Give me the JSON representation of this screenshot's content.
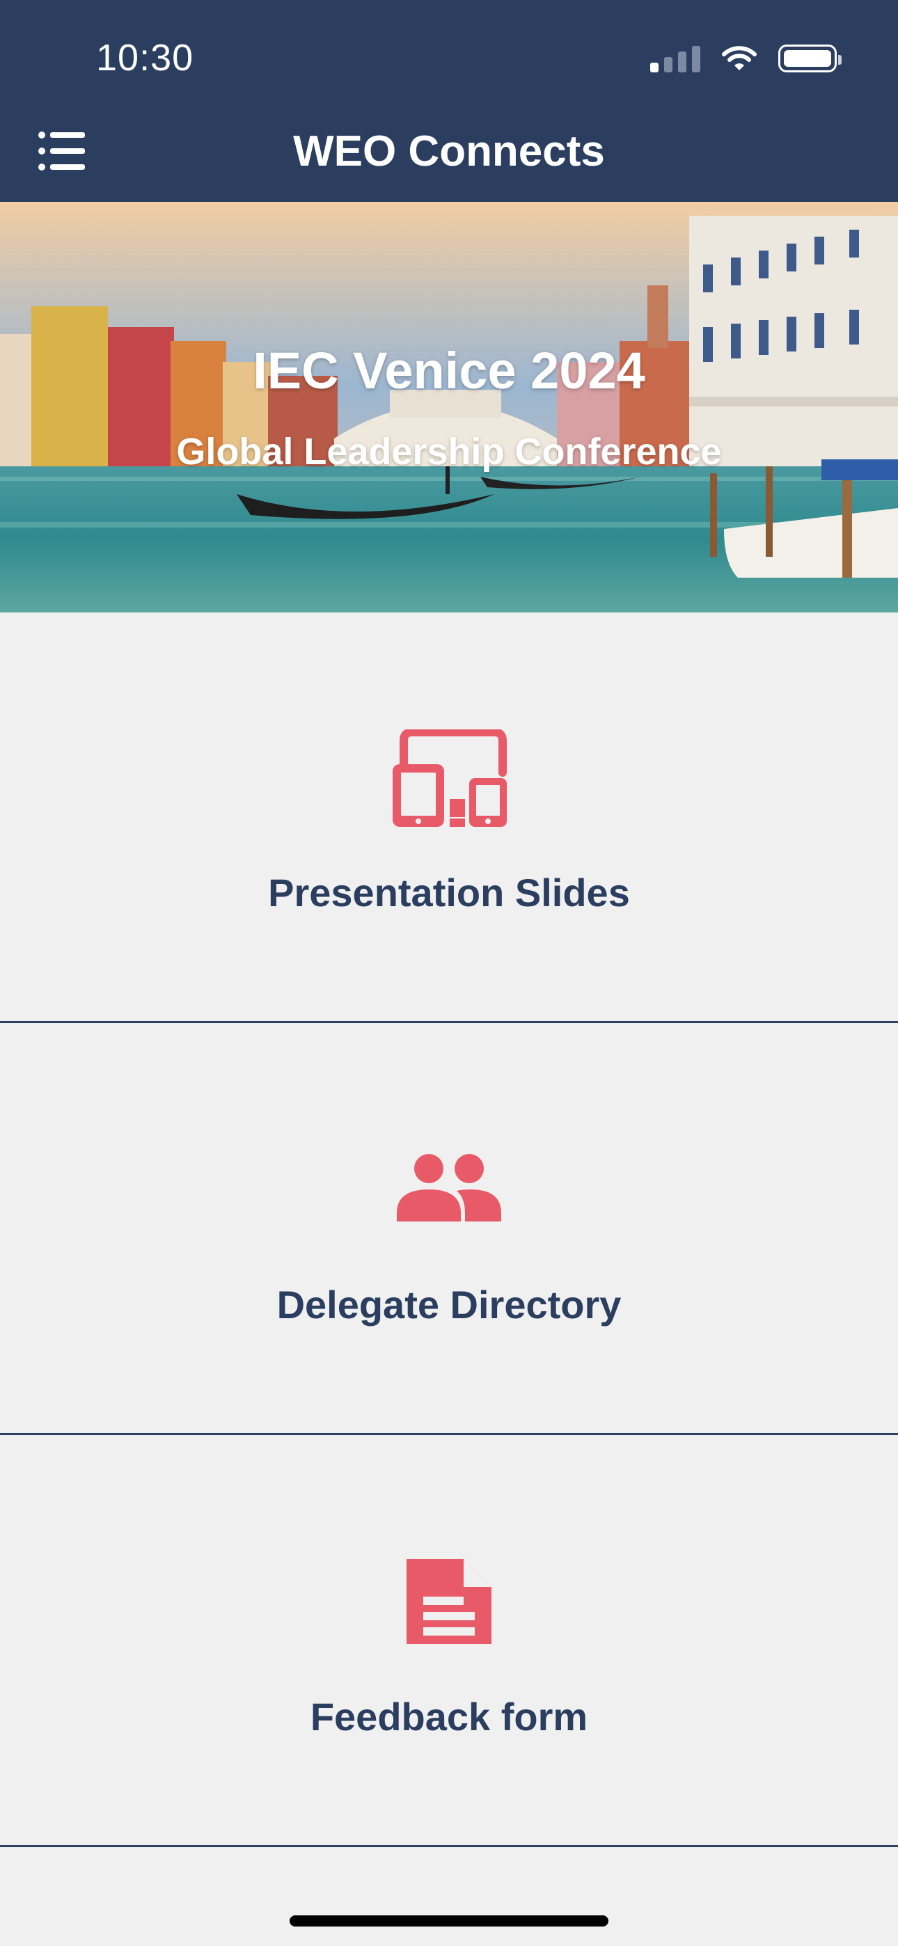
{
  "status_bar": {
    "time": "10:30"
  },
  "header": {
    "title": "WEO Connects",
    "menu_icon": "menu-list-icon"
  },
  "hero": {
    "title": "IEC Venice 2024",
    "subtitle": "Global Leadership Conference"
  },
  "tiles": [
    {
      "label": "Presentation Slides",
      "icon": "devices-icon"
    },
    {
      "label": "Delegate Directory",
      "icon": "people-icon"
    },
    {
      "label": "Feedback form",
      "icon": "document-icon"
    }
  ],
  "colors": {
    "header_bg": "#2b3e5f",
    "accent": "#e85a68",
    "text": "#2b3e5f",
    "page_bg": "#f0f0f0"
  }
}
